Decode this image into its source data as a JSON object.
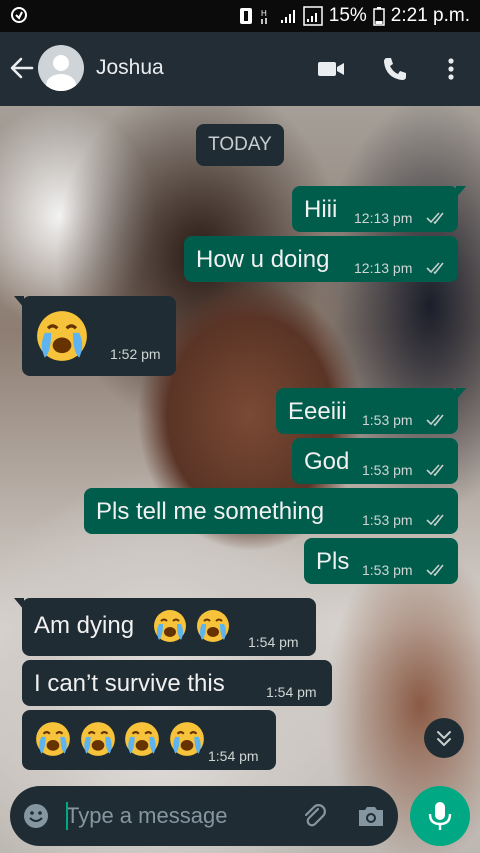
{
  "status_bar": {
    "battery": "15%",
    "time": "2:21 p.m."
  },
  "header": {
    "contact_name": "Joshua"
  },
  "chat": {
    "date_chip": "TODAY",
    "messages": [
      {
        "direction": "out",
        "text": "Hiii",
        "time": "12:13 pm",
        "status": "read"
      },
      {
        "direction": "out",
        "text": "How u doing",
        "time": "12:13 pm",
        "status": "read"
      },
      {
        "direction": "in",
        "text": "",
        "emoji": [
          "loudly-crying-face"
        ],
        "time": "1:52 pm"
      },
      {
        "direction": "out",
        "text": "Eeeiii",
        "time": "1:53 pm",
        "status": "read"
      },
      {
        "direction": "out",
        "text": "God",
        "time": "1:53 pm",
        "status": "read"
      },
      {
        "direction": "out",
        "text": "Pls tell me something",
        "time": "1:53 pm",
        "status": "read"
      },
      {
        "direction": "out",
        "text": "Pls",
        "time": "1:53 pm",
        "status": "read"
      },
      {
        "direction": "in",
        "text": "Am dying",
        "emoji": [
          "loudly-crying-face",
          "loudly-crying-face"
        ],
        "time": "1:54 pm"
      },
      {
        "direction": "in",
        "text": "I can’t survive this",
        "time": "1:54 pm"
      },
      {
        "direction": "in",
        "text": "",
        "emoji": [
          "loudly-crying-face",
          "loudly-crying-face",
          "loudly-crying-face",
          "loudly-crying-face"
        ],
        "time": "1:54 pm"
      }
    ]
  },
  "composer": {
    "placeholder": "Type a message"
  },
  "colors": {
    "header_bg": "#232d36",
    "outgoing_bubble": "#005c4b",
    "incoming_bubble": "#202c33",
    "accent": "#00a884",
    "read_ticks": "#c7d0ce"
  },
  "icons": {
    "status_left": "whatsapp-status-icon",
    "back": "back-arrow-icon",
    "video": "video-call-icon",
    "call": "phone-call-icon",
    "menu": "more-vertical-icon",
    "emoji": "emoji-icon",
    "attach": "paperclip-icon",
    "camera": "camera-icon",
    "mic": "microphone-icon",
    "scroll": "scroll-down-icon"
  }
}
